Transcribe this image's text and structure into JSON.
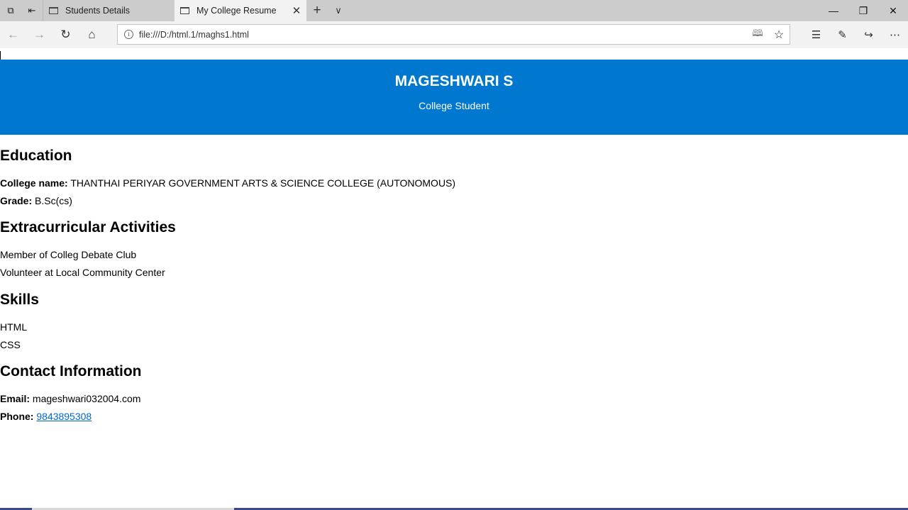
{
  "browser": {
    "tabs": [
      {
        "label": "Students Details",
        "active": false
      },
      {
        "label": "My College Resume",
        "active": true
      }
    ],
    "url": "file:///D:/html.1/maghs1.html"
  },
  "resume": {
    "name": "MAGESHWARI S",
    "role": "College Student",
    "education": {
      "heading": "Education",
      "college_label": "College name:",
      "college_value": " THANTHAI PERIYAR GOVERNMENT ARTS & SCIENCE COLLEGE (AUTONOMOUS)",
      "grade_label": "Grade:",
      "grade_value": " B.Sc(cs)"
    },
    "activities": {
      "heading": "Extracurricular Activities",
      "items": [
        "Member of Colleg Debate Club",
        "Volunteer at Local Community Center"
      ]
    },
    "skills": {
      "heading": "Skills",
      "items": [
        "HTML",
        "CSS"
      ]
    },
    "contact": {
      "heading": "Contact Information",
      "email_label": "Email:",
      "email_value": " mageshwari032004.com",
      "phone_label": "Phone:",
      "phone_value": "9843895308"
    }
  },
  "colors": {
    "header_bg": "#0078d0",
    "link": "#0066cc"
  }
}
